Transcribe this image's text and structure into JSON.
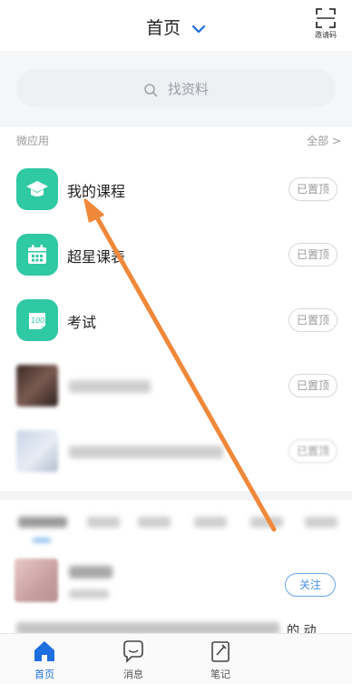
{
  "header": {
    "title": "首页",
    "scan_label": "邀请码"
  },
  "search": {
    "placeholder": "找资料"
  },
  "section": {
    "title": "微应用",
    "all_label": "全部 >"
  },
  "apps": [
    {
      "label": "我的课程",
      "pin_label": "已置顶",
      "icon": "graduation-cap-icon"
    },
    {
      "label": "超星课表",
      "pin_label": "已置顶",
      "icon": "calendar-icon"
    },
    {
      "label": "考试",
      "pin_label": "已置顶",
      "icon": "exam-100-icon"
    },
    {
      "label": "",
      "pin_label": "已置顶",
      "icon": "blurred-thumbnail"
    },
    {
      "label": "",
      "pin_label": "已置顶",
      "icon": "blurred-thumbnail"
    }
  ],
  "feed": {
    "follow_label": "关注",
    "trail_text": "的 动"
  },
  "tabbar": [
    {
      "label": "首页",
      "icon": "home-icon",
      "active": true
    },
    {
      "label": "消息",
      "icon": "chat-bubble-icon",
      "active": false
    },
    {
      "label": "笔记",
      "icon": "note-icon",
      "active": false
    }
  ],
  "colors": {
    "accent": "#1d6fe0",
    "app_tile": "#2fc9a4",
    "annotation_arrow": "#f0883a"
  }
}
